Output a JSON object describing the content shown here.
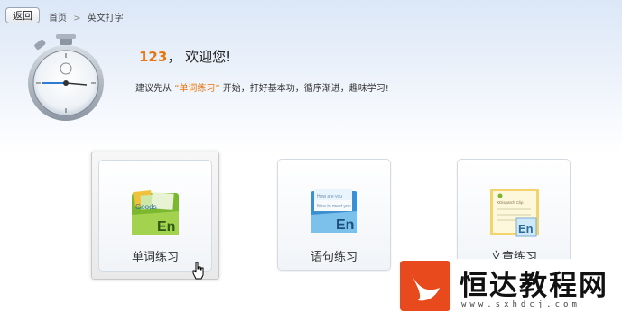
{
  "nav": {
    "back_label": "返回",
    "breadcrumb": {
      "home": "首页",
      "separator": ">",
      "current": "英文打字"
    }
  },
  "greeting": {
    "username": "123",
    "comma": "，",
    "welcome": "欢迎您!"
  },
  "hint": {
    "prefix": "建议先从",
    "highlight": "“单词练习”",
    "suffix": "开始，打好基本功，循序渐进，趣味学习!"
  },
  "cards": [
    {
      "label": "单词练习",
      "icon": "word-cards-icon",
      "icon_words": [
        "Goods",
        "En"
      ]
    },
    {
      "label": "语句练习",
      "icon": "sentence-folder-icon",
      "icon_words": [
        "How are you",
        "Nice to meet you",
        "En"
      ]
    },
    {
      "label": "文章练习",
      "icon": "article-note-icon",
      "icon_words": [
        "XDispatch Clip",
        "En"
      ]
    }
  ],
  "watermark": {
    "title": "恒达教程网",
    "url": "www.sxhdcj.com"
  },
  "colors": {
    "accent_orange": "#e8750c",
    "icon_green": "#8dc63f",
    "icon_blue": "#4aa3df",
    "watermark_red": "#e8491d"
  }
}
